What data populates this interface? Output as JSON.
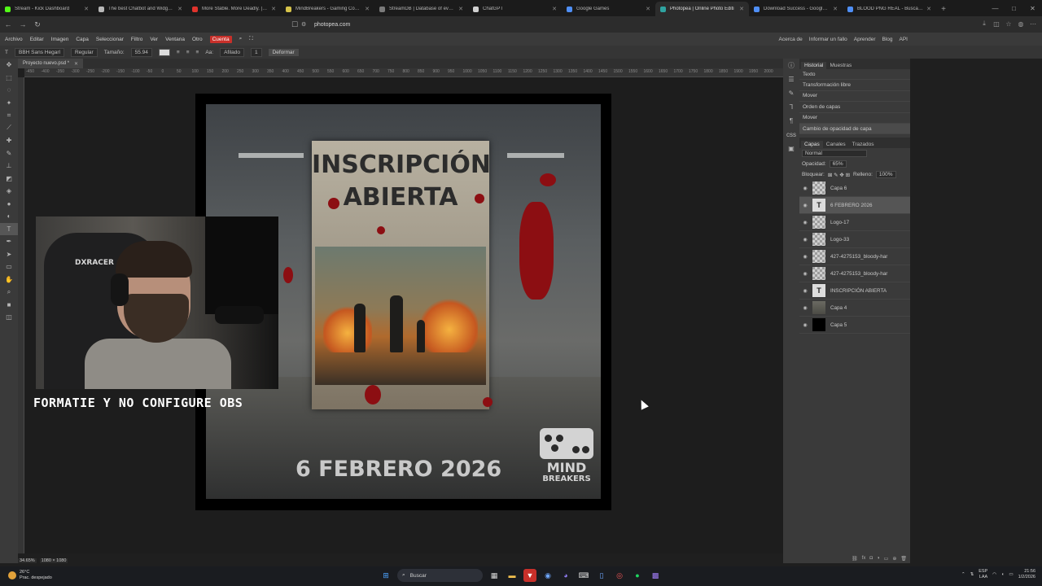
{
  "browser": {
    "tabs": [
      {
        "label": "Stream - Kick Dashboard",
        "color": "#53fc18"
      },
      {
        "label": "The best Chatbot and Widgets for",
        "color": "#b8b8b8"
      },
      {
        "label": "More Stable. More Deadly. | G.3.5.",
        "color": "#e0332c"
      },
      {
        "label": "MindBreakers - Gaming Communit",
        "color": "#d6c34a"
      },
      {
        "label": "StreamDB | Database of everything",
        "color": "#7a7a7a"
      },
      {
        "label": "ChatGPT",
        "color": "#d0d0d0"
      },
      {
        "label": "Google Games",
        "color": "#4f8ff7"
      },
      {
        "label": "Photopea | Online Photo Editi",
        "color": "#2fa3a0",
        "active": true
      },
      {
        "label": "Download Success - Google Fonts",
        "color": "#4f8ff7"
      },
      {
        "label": "BLOOD PNG REAL - Buscar con Go",
        "color": "#4f8ff7"
      }
    ],
    "url": "photopea.com"
  },
  "menu": {
    "items": [
      "Archivo",
      "Editar",
      "Imagen",
      "Capa",
      "Seleccionar",
      "Filtro",
      "Ver",
      "Ventana",
      "Otro",
      "Cuenta"
    ],
    "right": [
      "Acerca de",
      "Informar un fallo",
      "Aprender",
      "Blog",
      "API"
    ]
  },
  "options": {
    "font": "BBH Sans Hegarl",
    "style": "Regular",
    "size_label": "Tamaño:",
    "size": "55.94",
    "aa_label": "Aa:",
    "aa": "Afilado",
    "spacing": "1",
    "warp": "Deformar"
  },
  "document": {
    "tab": "Proyecto nuevo.psd *",
    "ruler_labels": [
      "-450",
      "-400",
      "-350",
      "-300",
      "-250",
      "-200",
      "-150",
      "-100",
      "-50",
      "0",
      "50",
      "100",
      "150",
      "200",
      "250",
      "300",
      "350",
      "400",
      "450",
      "500",
      "550",
      "600",
      "650",
      "700",
      "750",
      "800",
      "850",
      "900",
      "950",
      "1000",
      "1050",
      "1100",
      "1150",
      "1200",
      "1250",
      "1300",
      "1350",
      "1400",
      "1450",
      "1500",
      "1550",
      "1600",
      "1650",
      "1700",
      "1750",
      "1800",
      "1850",
      "1900",
      "1950",
      "2000"
    ],
    "zoom": "34.65%",
    "dimensions": "1080 × 1080"
  },
  "poster": {
    "title_line1": "INSCRIPCIÓN",
    "title_line2": "ABIERTA",
    "date": "6 FEBRERO 2026",
    "logo_line1": "MIND",
    "logo_line2": "BREAKERS"
  },
  "overlay": {
    "caption": "FORMATIE Y NO CONFIGURE OBS",
    "chair_brand": "DXRACER"
  },
  "history": {
    "tabs": [
      "Historial",
      "Muestras"
    ],
    "items": [
      "Texto",
      "Transformación libre",
      "Mover",
      "Orden de capas",
      "Mover",
      "Cambio de opacidad de capa"
    ]
  },
  "layers_panel": {
    "tabs": [
      "Capas",
      "Canales",
      "Trazados"
    ],
    "blend": "Normal",
    "opacity_label": "Opacidad:",
    "opacity": "65%",
    "lock_label": "Bloquear:",
    "fill_label": "Relleno:",
    "fill": "100%",
    "layers": [
      {
        "name": "Capa 6",
        "type": "checker"
      },
      {
        "name": "6 FEBRERO 2026",
        "type": "text",
        "selected": true
      },
      {
        "name": "Logo-17",
        "type": "checker"
      },
      {
        "name": "Logo-33",
        "type": "checker"
      },
      {
        "name": "427-4275153_bloody-har",
        "type": "checker"
      },
      {
        "name": "427-4275153_bloody-har",
        "type": "checker"
      },
      {
        "name": "INSCRIPCIÓN ABIERTA",
        "type": "text"
      },
      {
        "name": "Capa 4",
        "type": "img"
      },
      {
        "name": "Capa 5",
        "type": "black"
      }
    ]
  },
  "taskbar": {
    "weather_temp": "26°C",
    "weather_desc": "Prac. despejado",
    "search": "Buscar",
    "lang_top": "ESP",
    "lang_bottom": "LAA",
    "time": "21:56",
    "date": "1/2/2026"
  }
}
